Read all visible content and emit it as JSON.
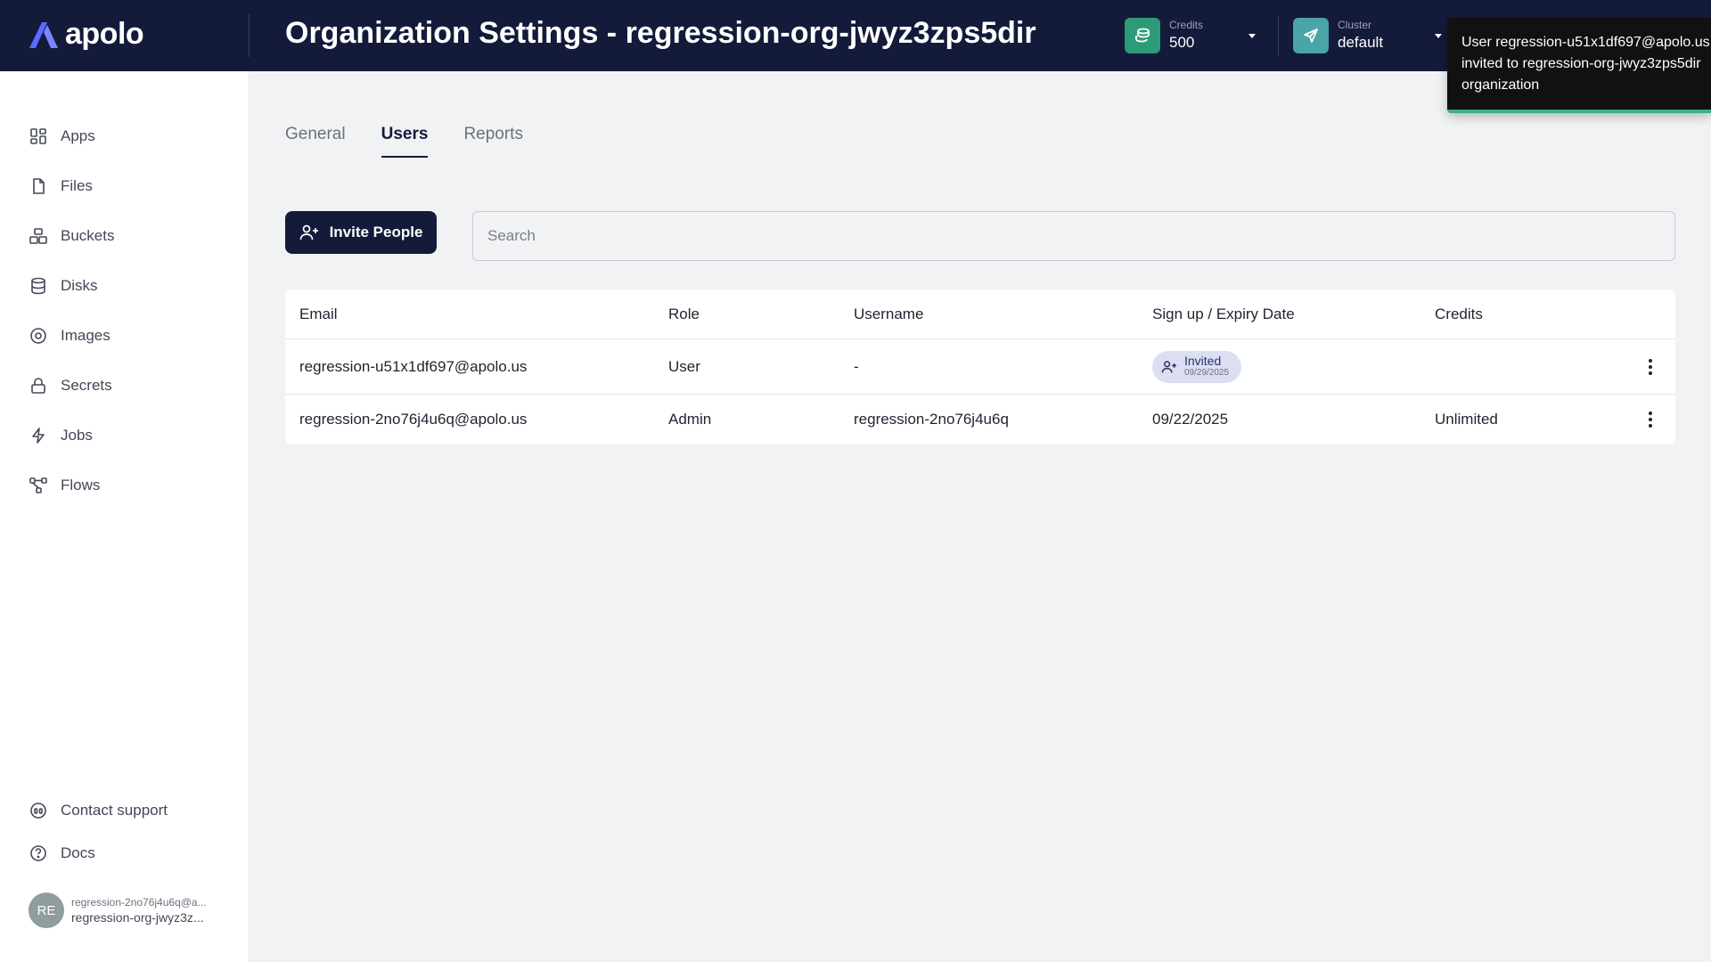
{
  "header": {
    "logo_text": "apolo",
    "title": "Organization Settings - regression-org-jwyz3zps5dir",
    "credits": {
      "label": "Credits",
      "value": "500",
      "icon": "coins-icon",
      "color": "#2d9b78"
    },
    "cluster": {
      "label": "Cluster",
      "value": "default",
      "icon": "send-icon",
      "color": "#4aa5a8"
    }
  },
  "toast": {
    "message": "User regression-u51x1df697@apolo.us invited to regression-org-jwyz3zps5dir organization",
    "accent": "#3fb083"
  },
  "sidebar": {
    "items": [
      {
        "label": "Apps",
        "icon": "apps-grid-icon"
      },
      {
        "label": "Files",
        "icon": "file-icon"
      },
      {
        "label": "Buckets",
        "icon": "buckets-icon"
      },
      {
        "label": "Disks",
        "icon": "database-icon"
      },
      {
        "label": "Images",
        "icon": "disc-icon"
      },
      {
        "label": "Secrets",
        "icon": "lock-icon"
      },
      {
        "label": "Jobs",
        "icon": "lightning-icon"
      },
      {
        "label": "Flows",
        "icon": "flow-icon"
      }
    ],
    "footer": [
      {
        "label": "Contact support",
        "icon": "headset-icon"
      },
      {
        "label": "Docs",
        "icon": "help-circle-icon"
      }
    ],
    "user": {
      "initials": "RE",
      "email": "regression-2no76j4u6q@a...",
      "org": "regression-org-jwyz3z..."
    }
  },
  "tabs": [
    {
      "label": "General",
      "active": false
    },
    {
      "label": "Users",
      "active": true
    },
    {
      "label": "Reports",
      "active": false
    }
  ],
  "toolbar": {
    "invite_label": "Invite People",
    "search_placeholder": "Search"
  },
  "table": {
    "columns": [
      "Email",
      "Role",
      "Username",
      "Sign up / Expiry Date",
      "Credits"
    ],
    "rows": [
      {
        "email": "regression-u51x1df697@apolo.us",
        "role": "User",
        "username": "-",
        "date": "",
        "status": "Invited",
        "status_date": "09/29/2025",
        "credits": ""
      },
      {
        "email": "regression-2no76j4u6q@apolo.us",
        "role": "Admin",
        "username": "regression-2no76j4u6q",
        "date": "09/22/2025",
        "status": "",
        "status_date": "",
        "credits": "Unlimited"
      }
    ]
  }
}
